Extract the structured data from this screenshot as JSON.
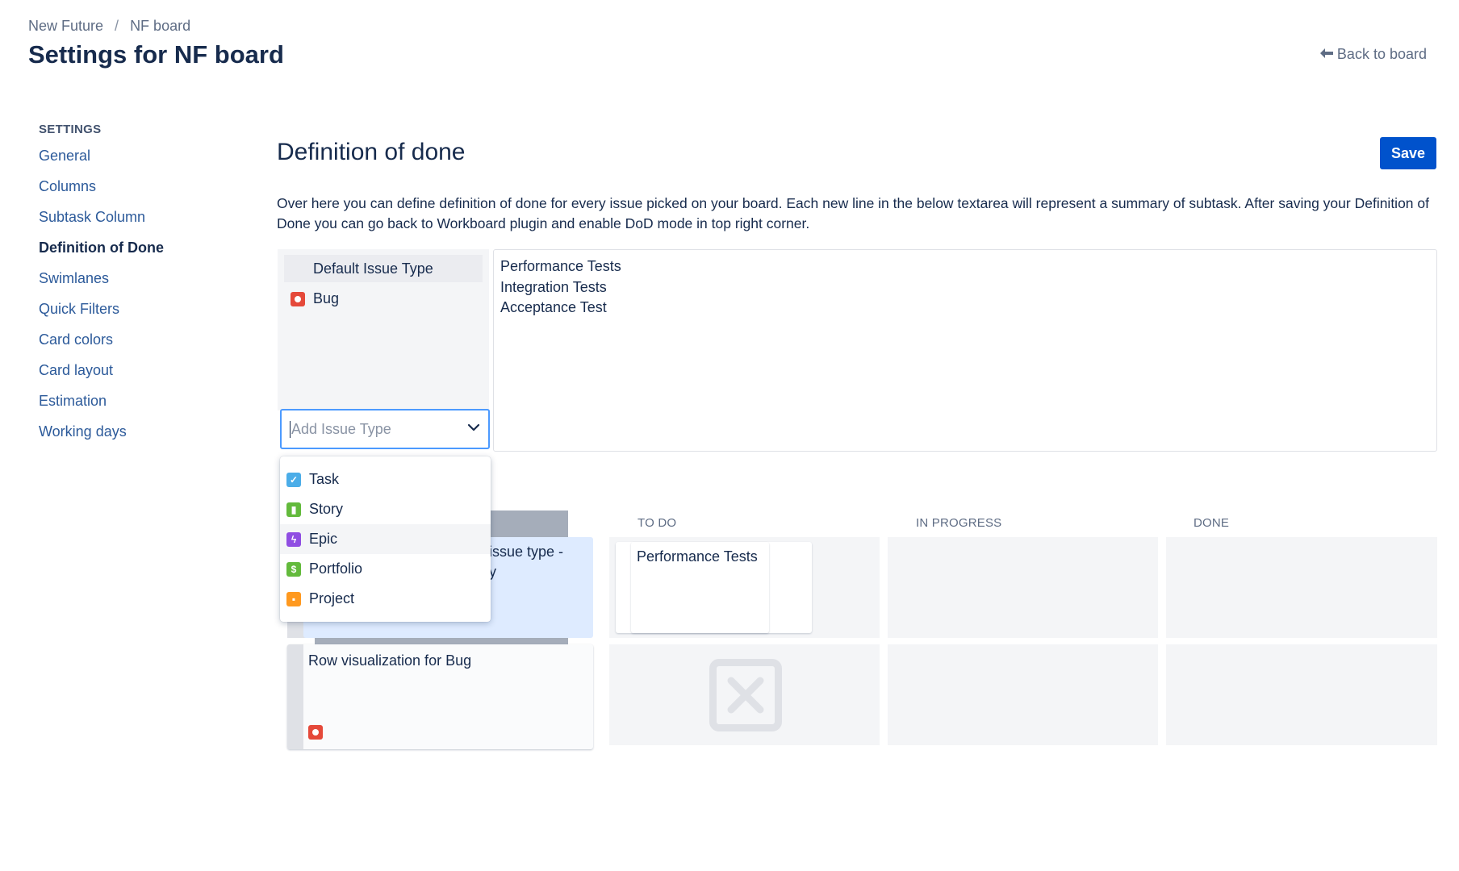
{
  "header": {
    "breadcrumb": [
      "New Future",
      "NF board"
    ],
    "breadcrumb_separator": "/",
    "title": "Settings for NF board",
    "back_label": "Back to board"
  },
  "sidebar": {
    "heading": "SETTINGS",
    "items": [
      {
        "label": "General",
        "active": false
      },
      {
        "label": "Columns",
        "active": false
      },
      {
        "label": "Subtask Column",
        "active": false
      },
      {
        "label": "Definition of Done",
        "active": true
      },
      {
        "label": "Swimlanes",
        "active": false
      },
      {
        "label": "Quick Filters",
        "active": false
      },
      {
        "label": "Card colors",
        "active": false
      },
      {
        "label": "Card layout",
        "active": false
      },
      {
        "label": "Estimation",
        "active": false
      },
      {
        "label": "Working days",
        "active": false
      }
    ]
  },
  "main": {
    "title": "Definition of done",
    "save_label": "Save",
    "description": "Over here you can define definition of done for every issue picked on your board. Each new line in the below textarea will represent a summary of subtask. After saving your Definition of Done you can go back to Workboard plugin and enable DoD mode in top right corner.",
    "issue_types": {
      "default_label": "Default Issue Type",
      "selected": [
        {
          "label": "Bug",
          "icon": "bug-icon"
        }
      ]
    },
    "dod_text": "Performance Tests\nIntegration Tests\nAcceptance Test",
    "add_issue_type": {
      "placeholder": "Add Issue Type",
      "options": [
        {
          "label": "Task",
          "icon": "task-icon",
          "glyph": "✓"
        },
        {
          "label": "Story",
          "icon": "story-icon",
          "glyph": "▮"
        },
        {
          "label": "Epic",
          "icon": "epic-icon",
          "glyph": "ϟ"
        },
        {
          "label": "Portfolio",
          "icon": "portfolio-icon",
          "glyph": "$"
        },
        {
          "label": "Project",
          "icon": "project-icon",
          "glyph": "▪"
        }
      ],
      "hovered_index": 2
    }
  },
  "board_preview": {
    "columns": [
      "TO DO",
      "IN PROGRESS",
      "DONE"
    ],
    "row1_label": "issue type -\ny",
    "row1_card": "Performance Tests",
    "row2_label": "Row visualization for Bug"
  },
  "colors": {
    "primary": "#0052cc",
    "focus_border": "#4c9aff",
    "bug": "#e5493a",
    "task": "#4bade8",
    "story": "#63ba3c",
    "epic": "#904ee2",
    "project": "#ff991f"
  }
}
